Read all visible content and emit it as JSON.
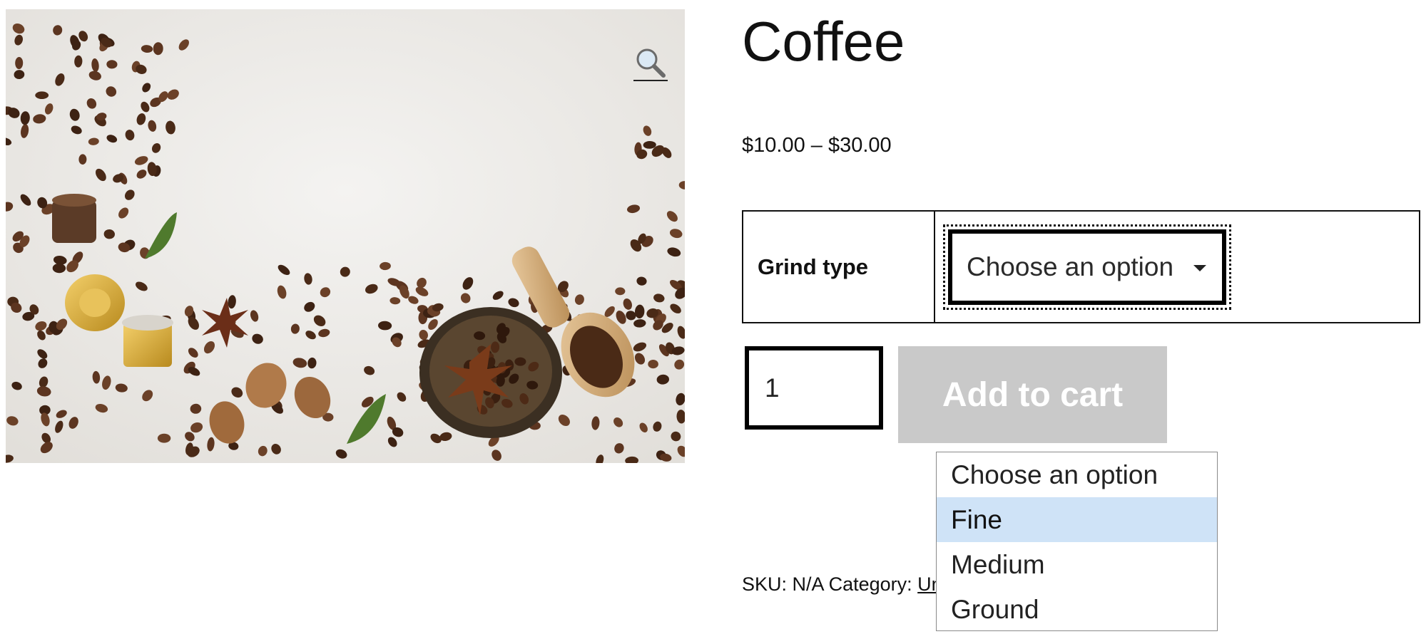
{
  "product": {
    "title": "Coffee",
    "price_range": "$10.00 – $30.00",
    "image_icon": "magnifier-icon"
  },
  "variations": {
    "label": "Grind type",
    "selected_value": "Choose an option",
    "options": [
      "Choose an option",
      "Fine",
      "Medium",
      "Ground"
    ],
    "highlighted_option": "Fine"
  },
  "cart": {
    "quantity": "1",
    "add_to_cart_label": "Add to cart",
    "disabled_color": "#c9c9c9"
  },
  "meta": {
    "sku_label": "SKU:",
    "sku_value": "N/A",
    "category_label": "Category:",
    "category_visible_text": "Un"
  }
}
